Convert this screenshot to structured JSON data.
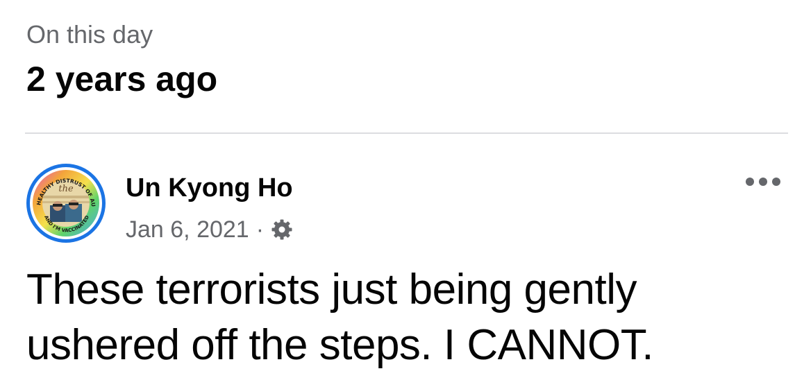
{
  "memory": {
    "label": "On this day",
    "title": "2 years ago"
  },
  "post": {
    "author": "Un Kyong Ho",
    "date": "Jan 6, 2021",
    "separator": "·",
    "privacy_icon": "gear-icon",
    "more_icon": "more-options-icon",
    "text": "These terrorists just being gently ushered off the steps. I CANNOT.",
    "avatar": {
      "badge_top_text": "I HAVE A HEALTHY DISTRUST OF AUTHORITY",
      "badge_bottom_text": "AND I'M VACCINATED",
      "badge_center_text": "We the People",
      "ring_color": "#1b74e4"
    }
  },
  "colors": {
    "text_primary": "#050505",
    "text_secondary": "#65676b",
    "divider": "#dcdde0",
    "accent": "#1b74e4"
  }
}
